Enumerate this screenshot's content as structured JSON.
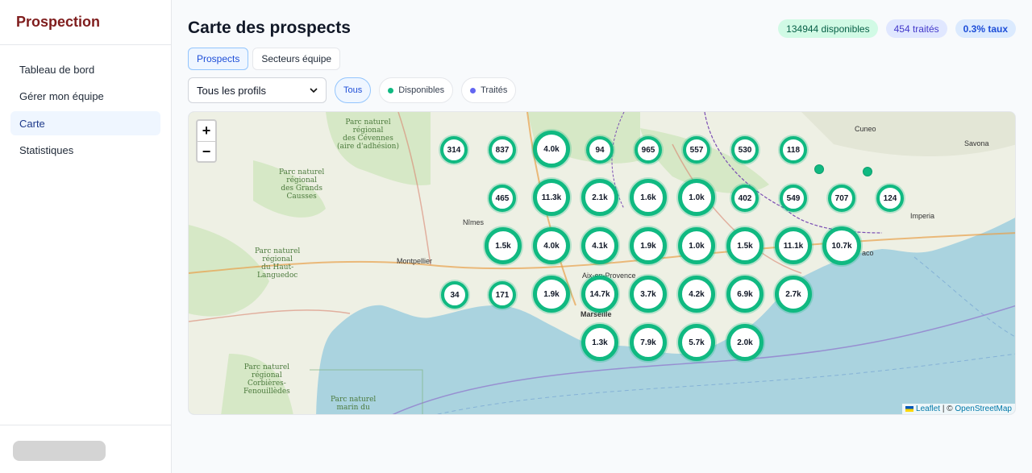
{
  "sidebar": {
    "brand": "Prospection",
    "brand_color": "#7f1d1d",
    "items": [
      {
        "label": "Tableau de bord",
        "active": false
      },
      {
        "label": "Gérer mon équipe",
        "active": false
      },
      {
        "label": "Carte",
        "active": true
      },
      {
        "label": "Statistiques",
        "active": false
      }
    ]
  },
  "header": {
    "title": "Carte des prospects",
    "stats": {
      "available": "134944 disponibles",
      "treated": "454 traités",
      "rate": "0.3% taux"
    }
  },
  "tabs": [
    {
      "label": "Prospects",
      "active": true
    },
    {
      "label": "Secteurs équipe",
      "active": false
    }
  ],
  "filters": {
    "profile_select": "Tous les profils",
    "chips": [
      {
        "label": "Tous",
        "active": true
      },
      {
        "label": "Disponibles",
        "color": "#10b981"
      },
      {
        "label": "Traités",
        "color": "#6366f1"
      }
    ]
  },
  "map": {
    "zoom_in": "+",
    "zoom_out": "−",
    "attribution_leaflet": "Leaflet",
    "attribution_sep": " | © ",
    "attribution_osm": "OpenStreetMap",
    "clusters": [
      "314",
      "837",
      "4.0k",
      "94",
      "965",
      "557",
      "530",
      "118",
      "465",
      "11.3k",
      "2.1k",
      "1.6k",
      "1.0k",
      "402",
      "549",
      "707",
      "124",
      "1.5k",
      "4.0k",
      "4.1k",
      "1.9k",
      "1.0k",
      "1.5k",
      "11.1k",
      "10.7k",
      "34",
      "171",
      "1.9k",
      "14.7k",
      "3.7k",
      "4.2k",
      "6.9k",
      "2.7k",
      "1.3k",
      "7.9k",
      "5.7k",
      "2.0k"
    ],
    "labels": {
      "cevennes": "Parc naturel\nrégional\ndes Cévennes\n(aire d'adhésion)",
      "grands_causses": "Parc naturel\nrégional\ndes Grands\nCausses",
      "haut_languedoc": "Parc naturel\nrégional\ndu Haut-\nLanguedoc",
      "corbieres": "Parc naturel\nrégional\nCorbières-\nFenouillèdes",
      "marin": "Parc naturel\nmarin du",
      "nimes": "Nîmes",
      "montpellier": "Montpellier",
      "marseille": "Marseille",
      "aix": "Aix-en-Provence",
      "cuneo": "Cuneo",
      "savona": "Savona",
      "imperia": "Imperia",
      "monaco": "aco"
    }
  }
}
